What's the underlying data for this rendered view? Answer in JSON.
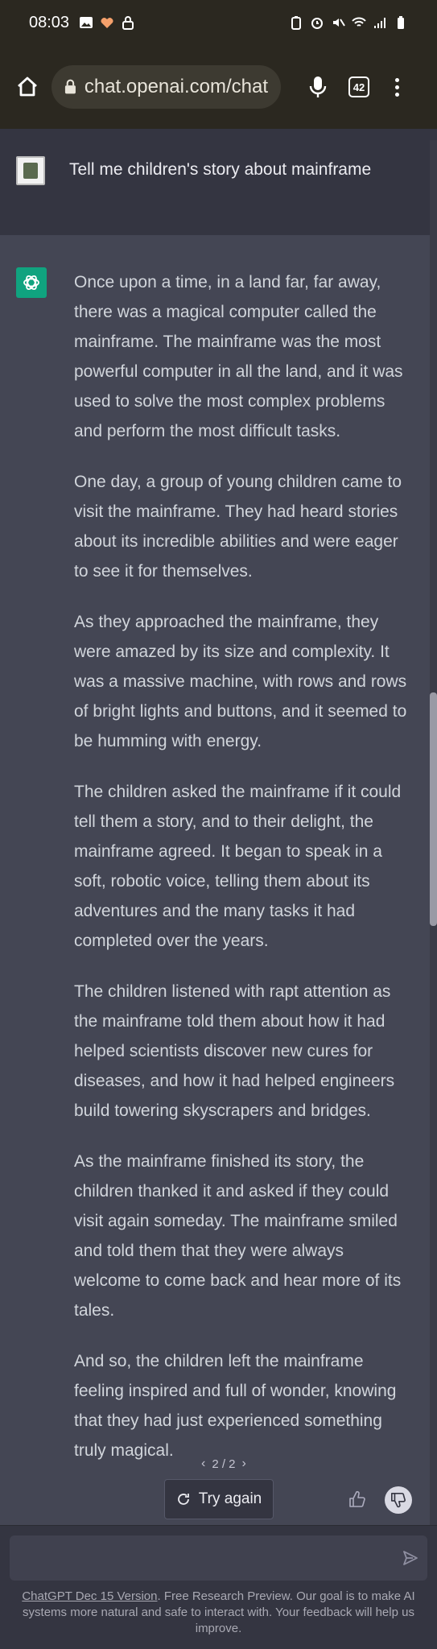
{
  "status_bar": {
    "time": "08:03",
    "left_icons": [
      "image-icon",
      "heart-monitor-icon",
      "lock-icon"
    ],
    "right_icons": [
      "battery-saver-icon",
      "alarm-icon",
      "mute-icon",
      "wifi-icon",
      "signal-icon",
      "signal-icon",
      "battery-icon"
    ]
  },
  "browser": {
    "url": "chat.openai.com/chat",
    "tab_count": "42"
  },
  "conversation": {
    "user_message": "Tell me children's story about mainframe",
    "assistant_paragraphs": [
      "Once upon a time, in a land far, far away, there was a magical computer called the mainframe. The mainframe was the most powerful computer in all the land, and it was used to solve the most complex problems and perform the most difficult tasks.",
      "One day, a group of young children came to visit the mainframe. They had heard stories about its incredible abilities and were eager to see it for themselves.",
      "As they approached the mainframe, they were amazed by its size and complexity. It was a massive machine, with rows and rows of bright lights and buttons, and it seemed to be humming with energy.",
      "The children asked the mainframe if it could tell them a story, and to their delight, the mainframe agreed. It began to speak in a soft, robotic voice, telling them about its adventures and the many tasks it had completed over the years.",
      "The children listened with rapt attention as the mainframe told them about how it had helped scientists discover new cures for diseases, and how it had helped engineers build towering skyscrapers and bridges.",
      "As the mainframe finished its story, the children thanked it and asked if they could visit again someday. The mainframe smiled and told them that they were always welcome to come back and hear more of its tales.",
      "And so, the children left the mainframe feeling inspired and full of wonder, knowing that they had just experienced something truly magical."
    ],
    "pager": "2 / 2",
    "try_again_label": "Try again"
  },
  "input": {
    "value": "",
    "placeholder": ""
  },
  "footer": {
    "link_text": "ChatGPT Dec 15 Version",
    "note_text": ". Free Research Preview. Our goal is to make AI systems more natural and safe to interact with. Your feedback will help us improve."
  },
  "colors": {
    "accent": "#10a37f",
    "chat_bg": "#444654",
    "user_bg": "#343541"
  }
}
